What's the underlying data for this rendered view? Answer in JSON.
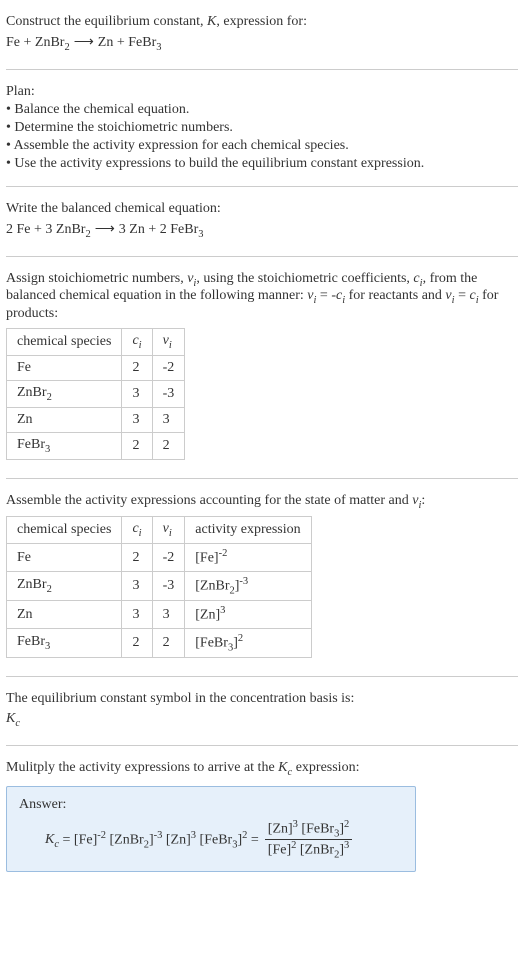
{
  "prompt": {
    "line1": "Construct the equilibrium constant, K, expression for:",
    "reaction_unbalanced": "Fe + ZnBr₂  ⟶  Zn + FeBr₃"
  },
  "plan": {
    "heading": "Plan:",
    "items": [
      "• Balance the chemical equation.",
      "• Determine the stoichiometric numbers.",
      "• Assemble the activity expression for each chemical species.",
      "• Use the activity expressions to build the equilibrium constant expression."
    ]
  },
  "balanced": {
    "heading": "Write the balanced chemical equation:",
    "equation": "2 Fe + 3 ZnBr₂  ⟶  3 Zn + 2 FeBr₃"
  },
  "stoich": {
    "text": "Assign stoichiometric numbers, νᵢ, using the stoichiometric coefficients, cᵢ, from the balanced chemical equation in the following manner: νᵢ = -cᵢ for reactants and νᵢ = cᵢ for products:",
    "headers": {
      "species": "chemical species",
      "ci": "cᵢ",
      "vi": "νᵢ"
    },
    "rows": [
      {
        "species": "Fe",
        "ci": "2",
        "vi": "-2"
      },
      {
        "species": "ZnBr₂",
        "ci": "3",
        "vi": "-3"
      },
      {
        "species": "Zn",
        "ci": "3",
        "vi": "3"
      },
      {
        "species": "FeBr₃",
        "ci": "2",
        "vi": "2"
      }
    ]
  },
  "activity": {
    "text": "Assemble the activity expressions accounting for the state of matter and νᵢ:",
    "headers": {
      "species": "chemical species",
      "ci": "cᵢ",
      "vi": "νᵢ",
      "expr": "activity expression"
    },
    "rows": [
      {
        "species": "Fe",
        "ci": "2",
        "vi": "-2",
        "expr": "[Fe]⁻²"
      },
      {
        "species": "ZnBr₂",
        "ci": "3",
        "vi": "-3",
        "expr": "[ZnBr₂]⁻³"
      },
      {
        "species": "Zn",
        "ci": "3",
        "vi": "3",
        "expr": "[Zn]³"
      },
      {
        "species": "FeBr₃",
        "ci": "2",
        "vi": "2",
        "expr": "[FeBr₃]²"
      }
    ]
  },
  "symbol": {
    "text": "The equilibrium constant symbol in the concentration basis is:",
    "sym": "K_c"
  },
  "multiply": {
    "text": "Mulitply the activity expressions to arrive at the K_c expression:"
  },
  "answer": {
    "label": "Answer:",
    "lhs": "K_c = [Fe]⁻² [ZnBr₂]⁻³ [Zn]³ [FeBr₃]² = ",
    "num": "[Zn]³ [FeBr₃]²",
    "den": "[Fe]² [ZnBr₂]³"
  },
  "chart_data": {
    "type": "table",
    "tables": [
      {
        "title": "Stoichiometric numbers",
        "columns": [
          "chemical species",
          "c_i",
          "v_i"
        ],
        "rows": [
          [
            "Fe",
            2,
            -2
          ],
          [
            "ZnBr2",
            3,
            -3
          ],
          [
            "Zn",
            3,
            3
          ],
          [
            "FeBr3",
            2,
            2
          ]
        ]
      },
      {
        "title": "Activity expressions",
        "columns": [
          "chemical species",
          "c_i",
          "v_i",
          "activity expression"
        ],
        "rows": [
          [
            "Fe",
            2,
            -2,
            "[Fe]^-2"
          ],
          [
            "ZnBr2",
            3,
            -3,
            "[ZnBr2]^-3"
          ],
          [
            "Zn",
            3,
            3,
            "[Zn]^3"
          ],
          [
            "FeBr3",
            2,
            2,
            "[FeBr3]^2"
          ]
        ]
      }
    ],
    "equilibrium_constant": "K_c = [Zn]^3 [FeBr3]^2 / ( [Fe]^2 [ZnBr2]^3 )"
  }
}
